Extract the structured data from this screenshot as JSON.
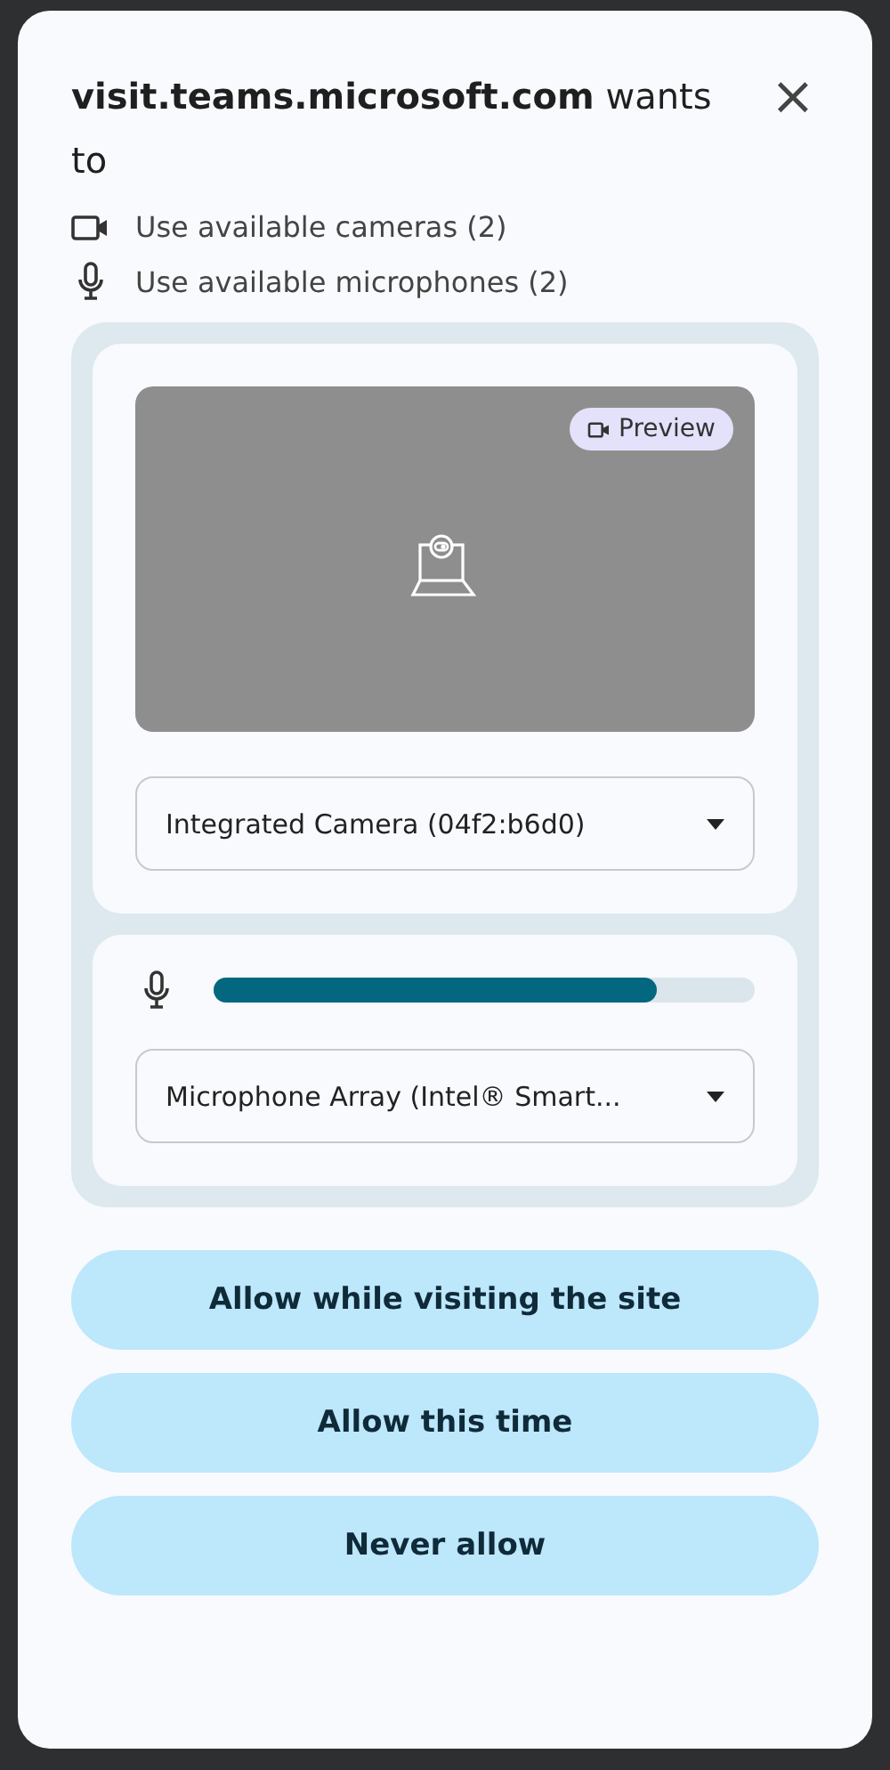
{
  "dialog": {
    "title": "**visit.teams.microsoft.com** wants to",
    "close": "×"
  },
  "permissions": [
    {
      "kind": "camera",
      "label": "Use available cameras (2)"
    },
    {
      "kind": "microphone",
      "label": "Use available microphones (2)"
    }
  ],
  "camera_panel": {
    "badge": "Preview",
    "device": "Integrated Camera (04f2:b6d0)"
  },
  "microphone_panel": {
    "level": 0.82,
    "device": "Microphone Array (Intel® Smart..."
  },
  "buttons": [
    "Allow while visiting the site",
    "Allow this time",
    "Never allow"
  ]
}
